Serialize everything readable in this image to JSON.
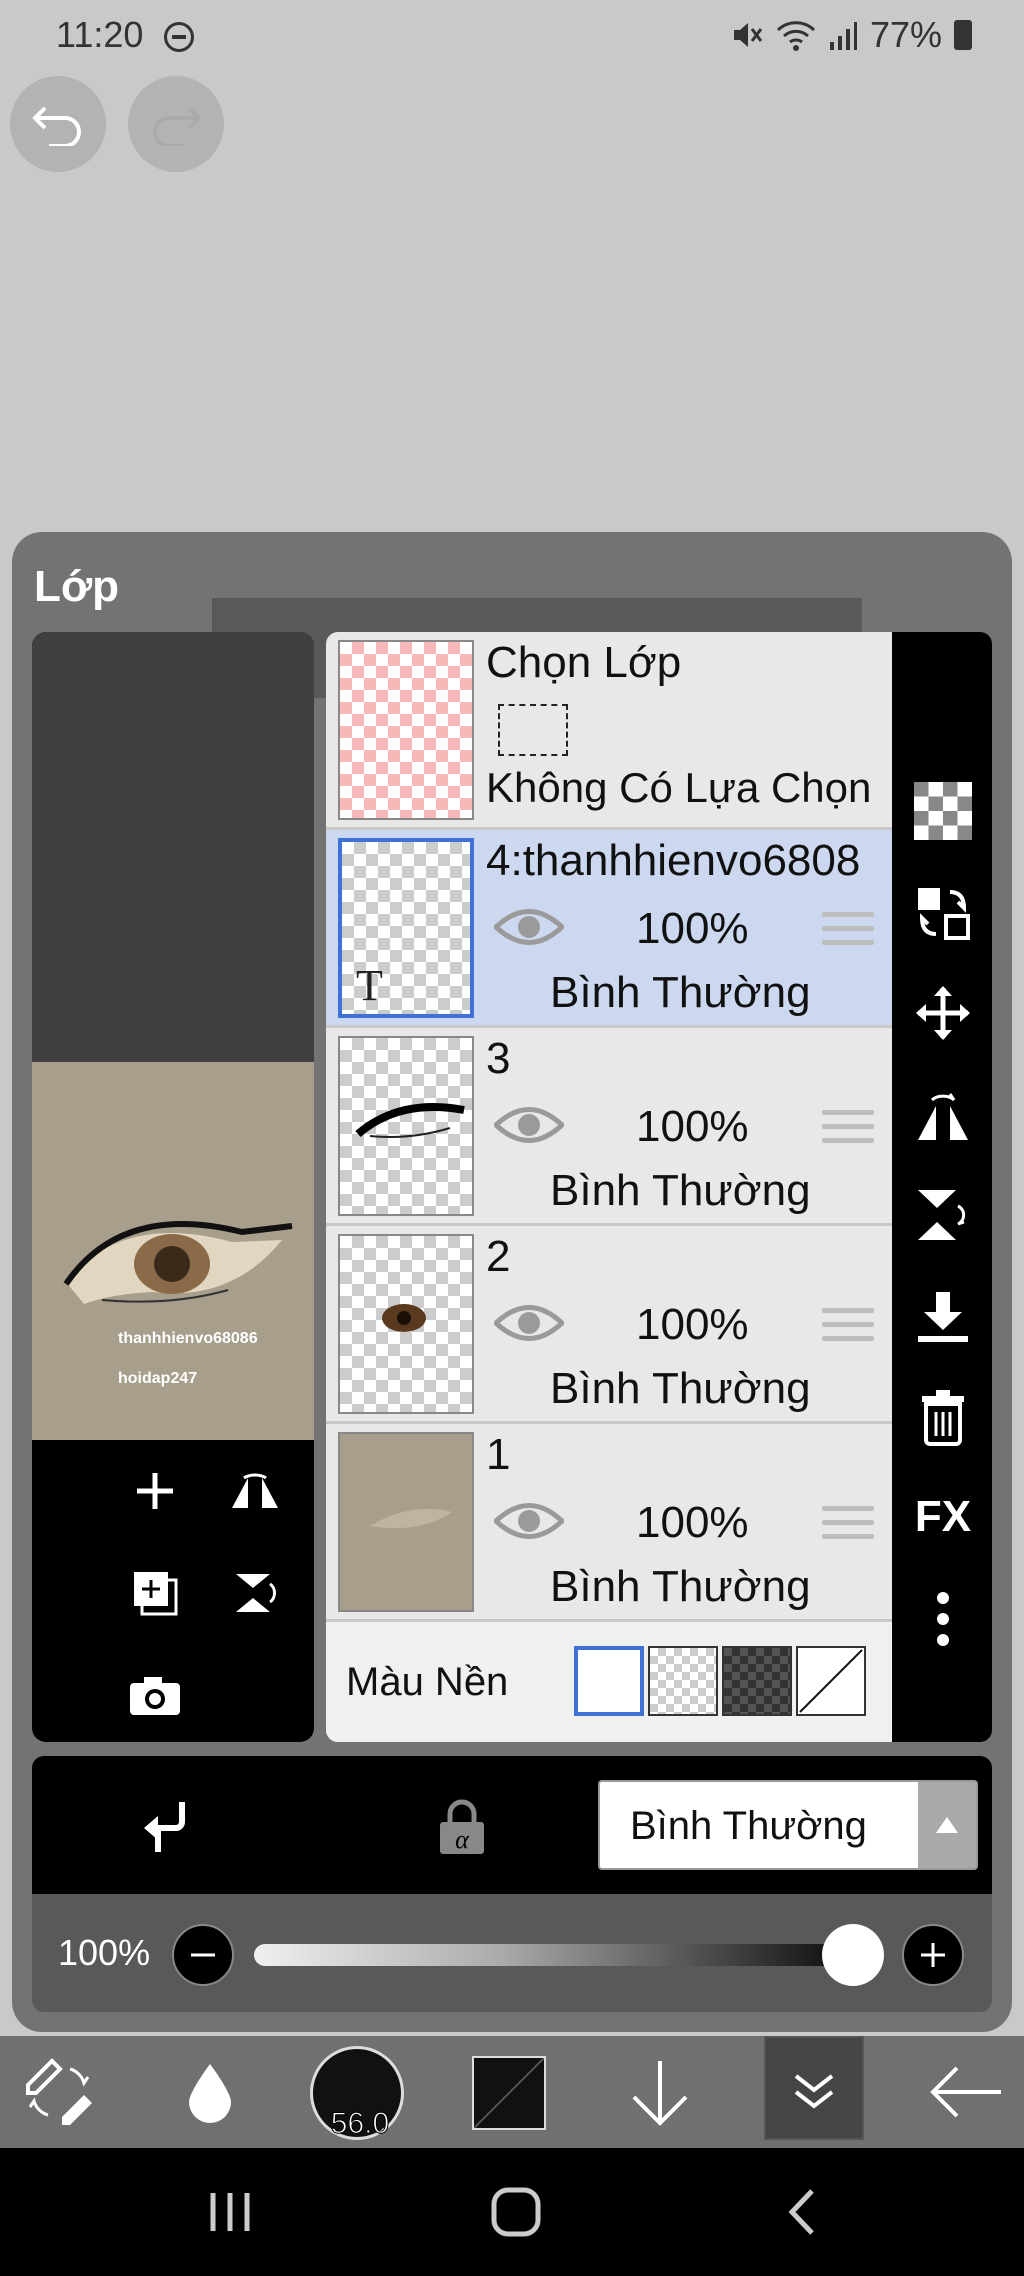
{
  "status": {
    "time": "11:20",
    "battery": "77%"
  },
  "panel": {
    "title": "Lớp"
  },
  "preview": {
    "watermark_line1": "thanhhienvo68086",
    "watermark_line2": "hoidap247"
  },
  "layers": {
    "selection_layer": {
      "name": "Chọn Lớp",
      "status": "Không Có Lựa Chọn"
    },
    "items": [
      {
        "name": "4:thanhhienvo6808",
        "opacity": "100%",
        "blend": "Bình Thường",
        "selected": true
      },
      {
        "name": "3",
        "opacity": "100%",
        "blend": "Bình Thường",
        "selected": false
      },
      {
        "name": "2",
        "opacity": "100%",
        "blend": "Bình Thường",
        "selected": false
      },
      {
        "name": "1",
        "opacity": "100%",
        "blend": "Bình Thường",
        "selected": false
      }
    ],
    "background": {
      "label": "Màu Nền",
      "selected": "white"
    }
  },
  "right_tools": {
    "fx_label": "FX"
  },
  "blend_bar": {
    "mode": "Bình Thường"
  },
  "opacity_bar": {
    "label": "100%",
    "value": 1.0
  },
  "bottom_tools": {
    "brush_size": "56.0"
  },
  "colors": {
    "selected_layer": "#ccd8ef",
    "accent": "#3d73d6"
  }
}
